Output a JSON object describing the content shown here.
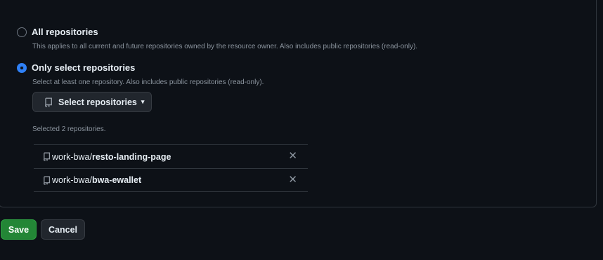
{
  "repository_access": {
    "options": [
      {
        "label": "All repositories",
        "description": "This applies to all current and future repositories owned by the resource owner. Also includes public repositories (read-only).",
        "selected": false
      },
      {
        "label": "Only select repositories",
        "description": "Select at least one repository. Also includes public repositories (read-only).",
        "selected": true
      }
    ],
    "select_button": {
      "label": "Select repositories",
      "icon": "repo-icon",
      "caret_icon": "caret-down-icon"
    },
    "selected_count_text": "Selected 2 repositories.",
    "selected_repos": [
      {
        "owner_prefix": "work-bwa/",
        "name": "resto-landing-page",
        "remove_icon": "close-icon"
      },
      {
        "owner_prefix": "work-bwa/",
        "name": "bwa-ewallet",
        "remove_icon": "close-icon"
      }
    ]
  },
  "actions": {
    "save_label": "Save",
    "cancel_label": "Cancel"
  },
  "colors": {
    "background": "#0d1117",
    "border": "#30363d",
    "accent_blue": "#2f81f7",
    "save_green": "#238636",
    "muted_text": "#8b949e"
  }
}
